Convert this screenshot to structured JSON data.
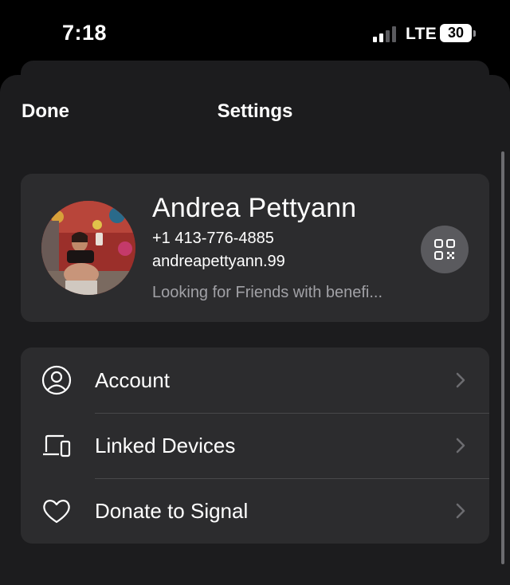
{
  "status_bar": {
    "time": "7:18",
    "network": "LTE",
    "battery": "30"
  },
  "nav": {
    "done_label": "Done",
    "title": "Settings"
  },
  "profile": {
    "name": "Andrea Pettyann",
    "phone": "+1 413-776-4885",
    "username": "andreapettyann.99",
    "about": "Looking for Friends with benefi...",
    "qr_icon": "qr-code-icon"
  },
  "menu": {
    "items": [
      {
        "label": "Account",
        "icon": "person-circle-icon"
      },
      {
        "label": "Linked Devices",
        "icon": "devices-icon"
      },
      {
        "label": "Donate to Signal",
        "icon": "heart-icon"
      }
    ]
  },
  "colors": {
    "background": "#000000",
    "sheet": "#1c1c1e",
    "card": "#2c2c2e",
    "secondary_text": "#a1a1a6",
    "divider": "#48484a"
  }
}
